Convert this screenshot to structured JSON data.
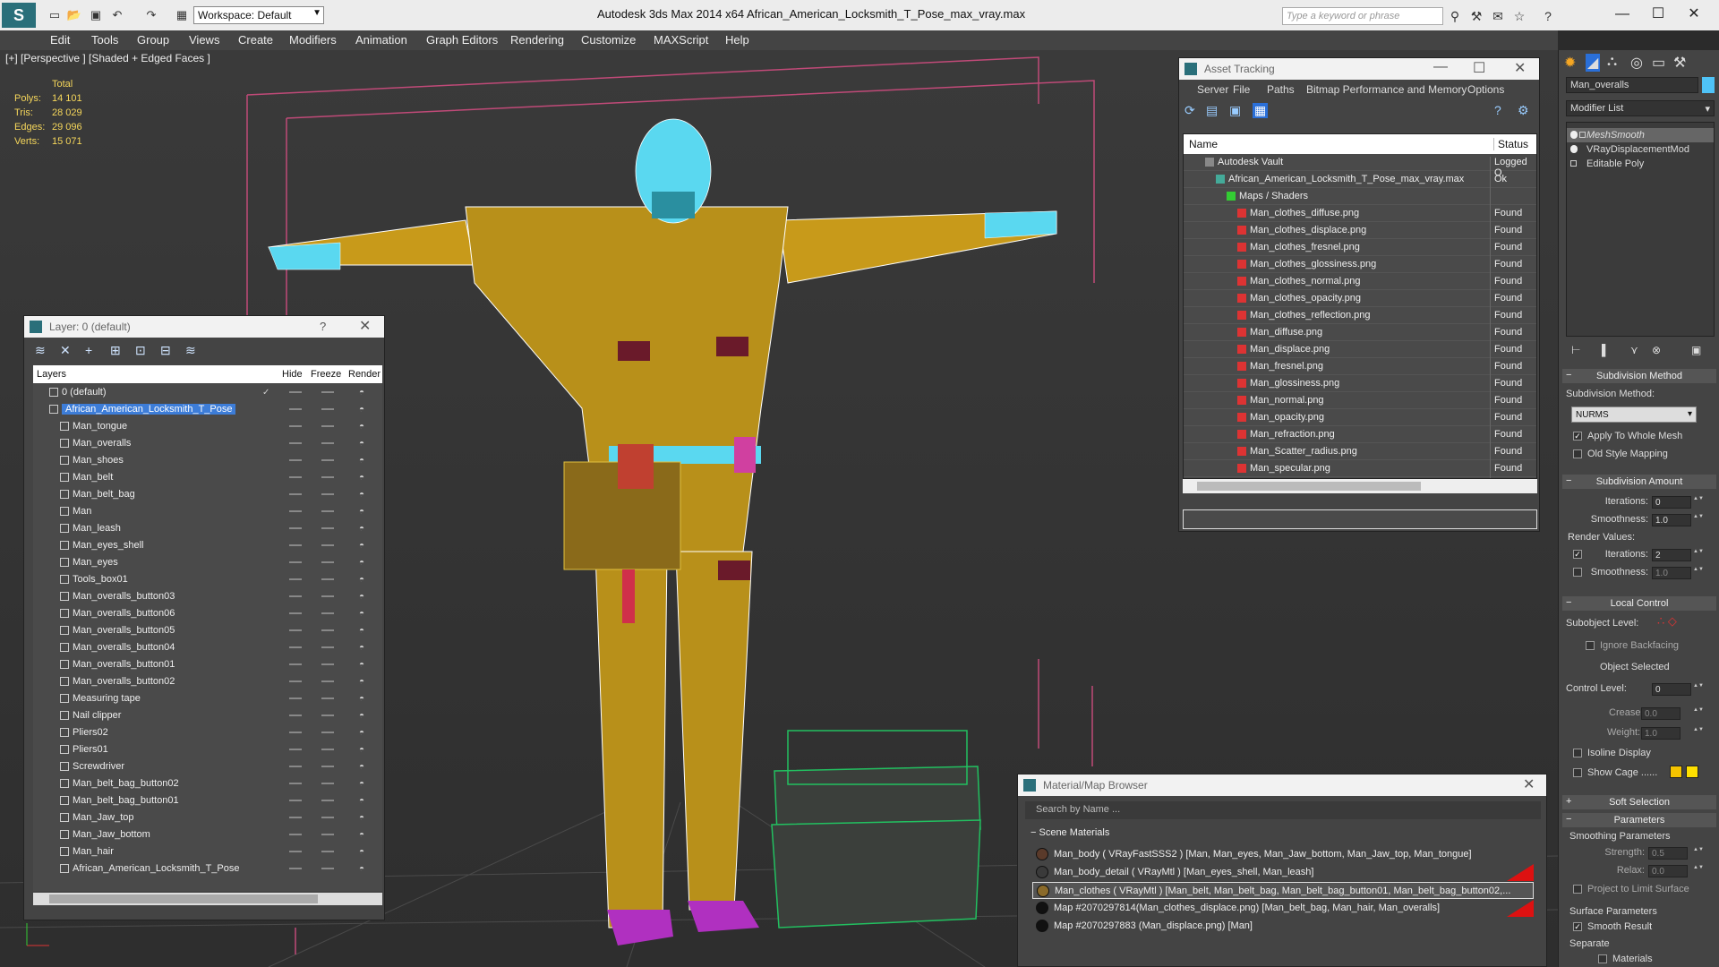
{
  "titlebar": {
    "workspace": "Workspace: Default",
    "title": "Autodesk 3ds Max  2014 x64       African_American_Locksmith_T_Pose_max_vray.max",
    "search_placeholder": "Type a keyword or phrase"
  },
  "menu": [
    "Edit",
    "Tools",
    "Group",
    "Views",
    "Create",
    "Modifiers",
    "Animation",
    "Graph Editors",
    "Rendering",
    "Customize",
    "MAXScript",
    "Help"
  ],
  "viewport": {
    "label": "[+] [Perspective ] [Shaded + Edged Faces ]",
    "stats": {
      "header": "Total",
      "rows": [
        {
          "label": "Polys:",
          "value": "14 101"
        },
        {
          "label": "Tris:",
          "value": "28 029"
        },
        {
          "label": "Edges:",
          "value": "29 096"
        },
        {
          "label": "Verts:",
          "value": "15 071"
        }
      ]
    }
  },
  "layer_panel": {
    "title": "Layer: 0 (default)",
    "help": "?",
    "columns": {
      "layers": "Layers",
      "hide": "Hide",
      "freeze": "Freeze",
      "render": "Render"
    },
    "rows": [
      {
        "name": "0 (default)",
        "level": 0,
        "checked": true
      },
      {
        "name": "African_American_Locksmith_T_Pose",
        "level": 0,
        "selected": true
      },
      {
        "name": "Man_tongue",
        "level": 1
      },
      {
        "name": "Man_overalls",
        "level": 1
      },
      {
        "name": "Man_shoes",
        "level": 1
      },
      {
        "name": "Man_belt",
        "level": 1
      },
      {
        "name": "Man_belt_bag",
        "level": 1
      },
      {
        "name": "Man",
        "level": 1
      },
      {
        "name": "Man_leash",
        "level": 1
      },
      {
        "name": "Man_eyes_shell",
        "level": 1
      },
      {
        "name": "Man_eyes",
        "level": 1
      },
      {
        "name": "Tools_box01",
        "level": 1
      },
      {
        "name": "Man_overalls_button03",
        "level": 1
      },
      {
        "name": "Man_overalls_button06",
        "level": 1
      },
      {
        "name": "Man_overalls_button05",
        "level": 1
      },
      {
        "name": "Man_overalls_button04",
        "level": 1
      },
      {
        "name": "Man_overalls_button01",
        "level": 1
      },
      {
        "name": "Man_overalls_button02",
        "level": 1
      },
      {
        "name": "Measuring tape",
        "level": 1
      },
      {
        "name": "Nail clipper",
        "level": 1
      },
      {
        "name": "Pliers02",
        "level": 1
      },
      {
        "name": "Pliers01",
        "level": 1
      },
      {
        "name": "Screwdriver",
        "level": 1
      },
      {
        "name": "Man_belt_bag_button02",
        "level": 1
      },
      {
        "name": "Man_belt_bag_button01",
        "level": 1
      },
      {
        "name": "Man_Jaw_top",
        "level": 1
      },
      {
        "name": "Man_Jaw_bottom",
        "level": 1
      },
      {
        "name": "Man_hair",
        "level": 1
      },
      {
        "name": "African_American_Locksmith_T_Pose",
        "level": 1
      }
    ]
  },
  "asset_panel": {
    "title": "Asset Tracking",
    "menu": [
      "Server",
      "File",
      "Paths",
      "Bitmap Performance and Memory",
      "Options"
    ],
    "columns": {
      "name": "Name",
      "status": "Status"
    },
    "rows": [
      {
        "name": "Autodesk Vault",
        "status": "Logged O",
        "level": 0,
        "icon": "vault"
      },
      {
        "name": "African_American_Locksmith_T_Pose_max_vray.max",
        "status": "Ok",
        "level": 1,
        "icon": "max"
      },
      {
        "name": "Maps / Shaders",
        "status": "",
        "level": 2,
        "icon": "maps"
      },
      {
        "name": "Man_clothes_diffuse.png",
        "status": "Found",
        "level": 3,
        "icon": "png"
      },
      {
        "name": "Man_clothes_displace.png",
        "status": "Found",
        "level": 3,
        "icon": "png"
      },
      {
        "name": "Man_clothes_fresnel.png",
        "status": "Found",
        "level": 3,
        "icon": "png"
      },
      {
        "name": "Man_clothes_glossiness.png",
        "status": "Found",
        "level": 3,
        "icon": "png"
      },
      {
        "name": "Man_clothes_normal.png",
        "status": "Found",
        "level": 3,
        "icon": "png"
      },
      {
        "name": "Man_clothes_opacity.png",
        "status": "Found",
        "level": 3,
        "icon": "png"
      },
      {
        "name": "Man_clothes_reflection.png",
        "status": "Found",
        "level": 3,
        "icon": "png"
      },
      {
        "name": "Man_diffuse.png",
        "status": "Found",
        "level": 3,
        "icon": "png"
      },
      {
        "name": "Man_displace.png",
        "status": "Found",
        "level": 3,
        "icon": "png"
      },
      {
        "name": "Man_fresnel.png",
        "status": "Found",
        "level": 3,
        "icon": "png"
      },
      {
        "name": "Man_glossiness.png",
        "status": "Found",
        "level": 3,
        "icon": "png"
      },
      {
        "name": "Man_normal.png",
        "status": "Found",
        "level": 3,
        "icon": "png"
      },
      {
        "name": "Man_opacity.png",
        "status": "Found",
        "level": 3,
        "icon": "png"
      },
      {
        "name": "Man_refraction.png",
        "status": "Found",
        "level": 3,
        "icon": "png"
      },
      {
        "name": "Man_Scatter_radius.png",
        "status": "Found",
        "level": 3,
        "icon": "png"
      },
      {
        "name": "Man_specular.png",
        "status": "Found",
        "level": 3,
        "icon": "png"
      }
    ]
  },
  "material_panel": {
    "title": "Material/Map Browser",
    "search_placeholder": "Search by Name ...",
    "section": "Scene Materials",
    "rows": [
      {
        "text": "Man_body  ( VRayFastSSS2 ) [Man, Man_eyes, Man_Jaw_bottom, Man_Jaw_top, Man_tongue]",
        "flag": false,
        "swatch": "#5a3a2a"
      },
      {
        "text": "Man_body_detail  ( VRayMtl ) [Man_eyes_shell, Man_leash]",
        "flag": true,
        "swatch": "#3a3a3a"
      },
      {
        "text": "Man_clothes  ( VRayMtl ) [Man_belt, Man_belt_bag, Man_belt_bag_button01, Man_belt_bag_button02,...",
        "flag": false,
        "swatch": "#8a6a2a",
        "selected": true
      },
      {
        "text": "Map #2070297814(Man_clothes_displace.png)  [Man_belt_bag, Man_hair, Man_overalls]",
        "flag": true,
        "swatch": "#111111"
      },
      {
        "text": "Map #2070297883 (Man_displace.png)  [Man]",
        "flag": false,
        "swatch": "#111111"
      }
    ]
  },
  "command_panel": {
    "object_name": "Man_overalls",
    "modifier_list": "Modifier List",
    "stack": [
      "MeshSmooth",
      "VRayDisplacementMod",
      "Editable Poly"
    ],
    "subdivision_method": {
      "header": "Subdivision Method",
      "label": "Subdivision Method:",
      "value": "NURMS",
      "apply_whole_mesh": "Apply To Whole Mesh",
      "old_style": "Old Style Mapping"
    },
    "subdivision_amount": {
      "header": "Subdivision Amount",
      "iterations_label": "Iterations:",
      "iterations": "0",
      "smoothness_label": "Smoothness:",
      "smoothness": "1.0",
      "render_values": "Render Values:",
      "r_iterations": "2",
      "r_smoothness": "1.0"
    },
    "local_control": {
      "header": "Local Control",
      "subobject": "Subobject Level:",
      "ignore_backfacing": "Ignore Backfacing",
      "object_selected": "Object Selected",
      "control_level_label": "Control Level:",
      "control_level": "0",
      "crease_label": "Crease:",
      "crease": "0.0",
      "weight_label": "Weight:",
      "weight": "1.0",
      "isoline": "Isoline Display",
      "show_cage": "Show Cage ......"
    },
    "soft_selection": "Soft Selection",
    "parameters": {
      "header": "Parameters",
      "smoothing": "Smoothing Parameters",
      "strength_label": "Strength:",
      "strength": "0.5",
      "relax_label": "Relax:",
      "relax": "0.0",
      "project_limit": "Project to Limit Surface",
      "surface_params": "Surface Parameters",
      "smooth_result": "Smooth Result",
      "separate": "Separate",
      "materials": "Materials"
    }
  }
}
